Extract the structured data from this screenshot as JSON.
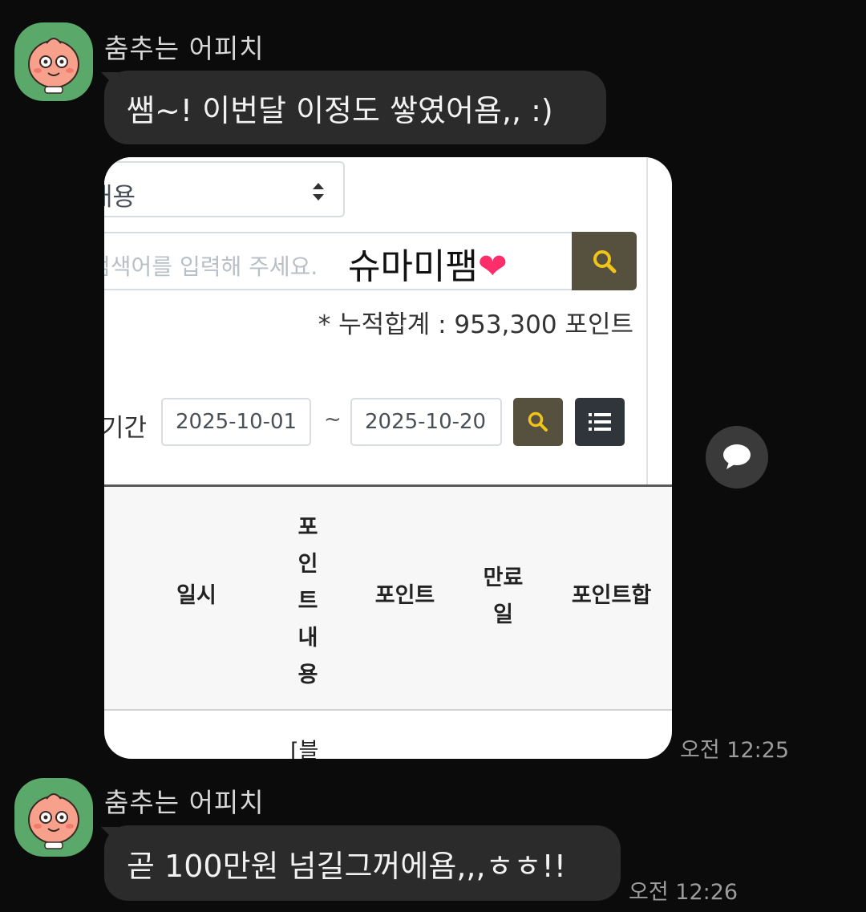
{
  "messages": [
    {
      "sender": "춤추는 어피치",
      "text": "쌤~! 이번달 이정도 쌓였어욤,, :)",
      "time": "오전 12:25"
    },
    {
      "sender": "춤추는 어피치",
      "text": "곧 100만원 넘길그꺼에욤,,,ㅎㅎ!!",
      "time": "오전 12:26"
    }
  ],
  "shared_image": {
    "select_value": "내용",
    "search_placeholder": "검색어를 입력해 주세요.",
    "search_typed": "슈마미팸",
    "search_emoji": "❤",
    "total_text": "* 누적합계 : 953,300 포인트",
    "period_label": "기간",
    "date_from": "2025-10-01",
    "date_sep": "~",
    "date_to": "2025-10-20",
    "table_headers": {
      "date": "일시",
      "content": [
        "포",
        "인",
        "트",
        "내",
        "용"
      ],
      "points": "포인트",
      "expiry": [
        "만료",
        "일"
      ],
      "total": "포인트합"
    },
    "first_cell_partial": "[블"
  },
  "icons": {
    "avatar": "apeach-avatar-icon",
    "search": "search-icon",
    "list": "list-icon",
    "select_arrow": "select-arrow-icon",
    "speech": "speech-bubble-icon"
  }
}
